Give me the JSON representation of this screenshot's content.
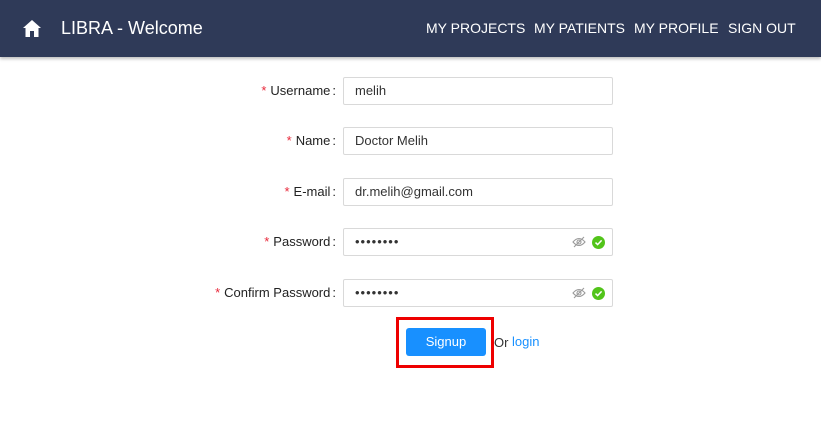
{
  "header": {
    "title": "LIBRA - Welcome",
    "home_icon": "home-icon",
    "nav": [
      {
        "label": "MY PROJECTS"
      },
      {
        "label": "MY PATIENTS"
      },
      {
        "label": "MY PROFILE"
      },
      {
        "label": "SIGN OUT"
      }
    ],
    "background_color": "#2f3a58"
  },
  "form": {
    "required_marker": "*",
    "fields": {
      "username": {
        "label": "Username",
        "value": "melih"
      },
      "name": {
        "label": "Name",
        "value": "Doctor Melih"
      },
      "email": {
        "label": "E-mail",
        "value": "dr.melih@gmail.com"
      },
      "password": {
        "label": "Password",
        "value": "••••••••",
        "visibility_icon": "eye-slash-icon",
        "status_icon": "check-circle-icon"
      },
      "confirm_password": {
        "label": "Confirm Password",
        "value": "••••••••",
        "visibility_icon": "eye-slash-icon",
        "status_icon": "check-circle-icon"
      }
    },
    "submit_label": "Signup",
    "alt_text": "Or",
    "alt_link": "login",
    "accent_color": "#1890ff",
    "success_color": "#52c41a",
    "highlight_color": "#ee0000"
  }
}
